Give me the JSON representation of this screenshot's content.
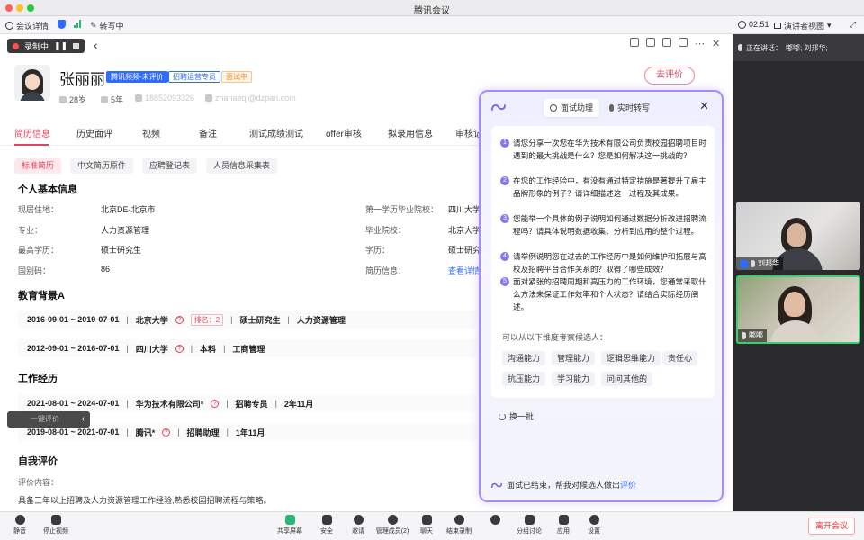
{
  "window": {
    "title": "腾讯会议"
  },
  "meeting_bar": {
    "details": "会议详情",
    "transcribe": "转写中",
    "timer": "02:51",
    "view": "演讲者视图"
  },
  "recording": {
    "label": "录制中"
  },
  "candidate": {
    "name": "张丽丽",
    "tags": [
      "腾讯频频-未评价",
      "招聘运营专员",
      "面试中"
    ],
    "age": "28岁",
    "experience": "5年",
    "phone": "18852093326",
    "email": "zhanaeqi@dzpan.com",
    "evaluate_button": "去评价"
  },
  "tabs": [
    "简历信息",
    "历史面评",
    "视频",
    "备注",
    "测试成绩测试",
    "offer审核",
    "拟录用信息",
    "审核记"
  ],
  "subtabs": [
    "标准简历",
    "中文简历原件",
    "应聘登记表",
    "人员信息采集表"
  ],
  "basic_info": {
    "title": "个人基本信息",
    "rows": [
      {
        "label": "现居住地：",
        "value": "北京DE-北京市"
      },
      {
        "label": "专业：",
        "value": "人力资源管理"
      },
      {
        "label": "最高学历：",
        "value": "硕士研究生"
      },
      {
        "label": "国别码：",
        "value": "86"
      }
    ],
    "right_rows": [
      {
        "label": "第一学历毕业院校：",
        "value": "四川大学"
      },
      {
        "label": "毕业院校：",
        "value": "北京大学"
      },
      {
        "label": "学历：",
        "value": "硕士研究"
      },
      {
        "label": "简历信息：",
        "value": "查看详情"
      }
    ]
  },
  "education": {
    "title": "教育背景A",
    "rows": [
      {
        "period": "2016-09-01 ~ 2019-07-01",
        "school": "北京大学",
        "rank": "排名：2",
        "degree": "硕士研究生",
        "major": "人力资源管理"
      },
      {
        "period": "2012-09-01 ~ 2016-07-01",
        "school": "四川大学",
        "degree": "本科",
        "major": "工商管理"
      }
    ]
  },
  "work": {
    "title": "工作经历",
    "rows": [
      {
        "period": "2021-08-01 ~ 2024-07-01",
        "company": "华为技术有限公司*",
        "role": "招聘专员",
        "duration": "2年11月"
      },
      {
        "period": "2019-08-01 ~ 2021-07-01",
        "company": "腾讯*",
        "role": "招聘助理",
        "duration": "1年11月"
      }
    ]
  },
  "self_eval": {
    "title": "自我评价",
    "label": "评价内容：",
    "text": "具备三年以上招聘及人力资源管理工作经验,熟悉校园招聘流程与策略。"
  },
  "toast": {
    "text": "一键评价"
  },
  "ai_panel": {
    "tab_assistant": "面试助理",
    "tab_transcribe": "实时转写",
    "questions": [
      "请您分享一次您在华为技术有限公司负责校园招聘项目时遇到的最大挑战是什么？您是如何解决这一挑战的？",
      "在您的工作经验中，有没有通过特定措施是著提升了雇主品牌形象的例子？请详细描述这一过程及其成果。",
      "您能举一个具体的例子说明如何通过数据分析改进招聘流程吗？请具体说明数据收集、分析到应用的整个过程。",
      "请举例说明您在过去的工作经历中是如何维护和拓展与高校及招聘平台合作关系的？取得了哪些成效？",
      "面对紧张的招聘周期和高压力的工作环境，您通常采取什么方法来保证工作效率和个人状态？请结合实际经历阐述。"
    ],
    "dimensions_title": "可以从以下维度考察候选人：",
    "dimensions": [
      "沟通能力",
      "管理能力",
      "逻辑思维能力",
      "责任心",
      "抗压能力",
      "学习能力",
      "问问其他的"
    ],
    "refresh": "换一批",
    "footer_text": "面试已结束，帮我对候选人做出",
    "footer_link": "评价"
  },
  "sidebar": {
    "speaking_label": "正在讲话：",
    "speaking_names": "嘟嘟; 刘邦华;",
    "participants": [
      "刘邦华",
      "嘟嘟"
    ]
  },
  "controls": {
    "items": [
      "静音",
      "停止视频",
      "共享屏幕",
      "安全",
      "邀请",
      "管理成员(2)",
      "聊天",
      "结束录制",
      "",
      "分组讨论",
      "应用",
      "设置"
    ],
    "leave": "离开会议"
  },
  "colors": {
    "accent": "#e0435b",
    "brand_blue": "#2f6bff",
    "ai_border": "#a98cf5"
  }
}
